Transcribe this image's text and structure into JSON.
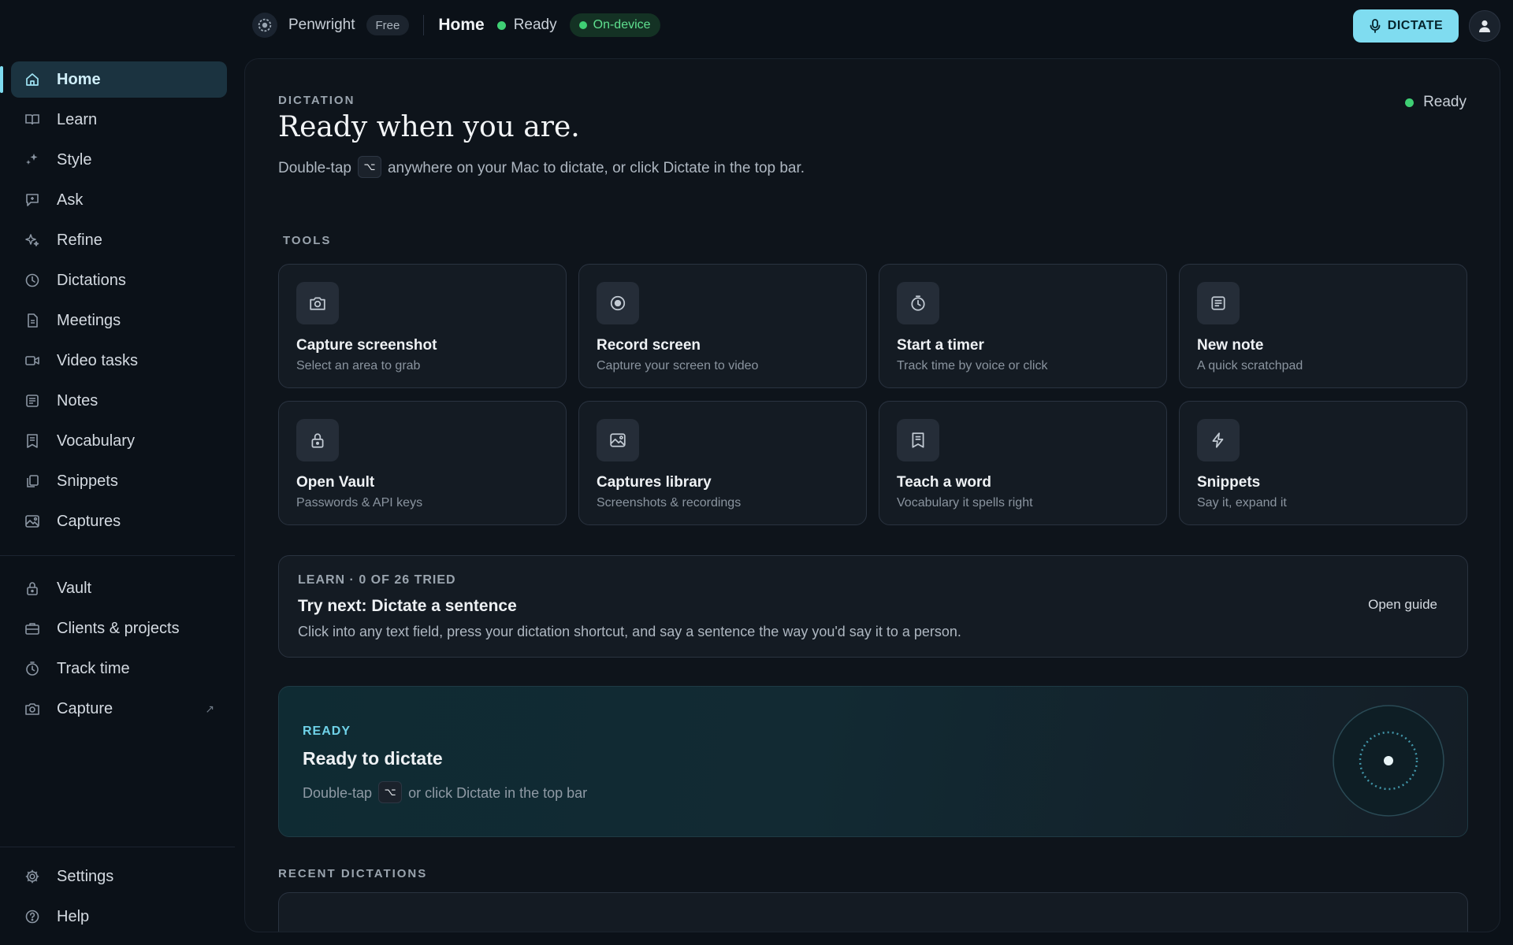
{
  "topbar": {
    "app_name": "Penwright",
    "plan": "Free",
    "page_title": "Home",
    "status": "Ready",
    "mode": "On-device",
    "dictate_label": "DICTATE"
  },
  "sidebar": {
    "primary": [
      {
        "label": "Home",
        "icon": "home-icon",
        "active": true
      },
      {
        "label": "Learn",
        "icon": "book-icon"
      },
      {
        "label": "Style",
        "icon": "sparkle-icon"
      },
      {
        "label": "Ask",
        "icon": "chat-icon"
      },
      {
        "label": "Refine",
        "icon": "stars-icon"
      },
      {
        "label": "Dictations",
        "icon": "clock-icon"
      },
      {
        "label": "Meetings",
        "icon": "document-icon"
      },
      {
        "label": "Video tasks",
        "icon": "video-icon"
      },
      {
        "label": "Notes",
        "icon": "notes-icon"
      },
      {
        "label": "Vocabulary",
        "icon": "bookmark-icon"
      },
      {
        "label": "Snippets",
        "icon": "copy-icon"
      },
      {
        "label": "Captures",
        "icon": "image-icon"
      }
    ],
    "secondary": [
      {
        "label": "Vault",
        "icon": "lock-icon"
      },
      {
        "label": "Clients & projects",
        "icon": "briefcase-icon"
      },
      {
        "label": "Track time",
        "icon": "timer-icon"
      },
      {
        "label": "Capture",
        "icon": "camera-icon",
        "external": "↗"
      }
    ],
    "footer": [
      {
        "label": "Settings",
        "icon": "gear-icon"
      },
      {
        "label": "Help",
        "icon": "help-icon"
      }
    ]
  },
  "main": {
    "section_label": "DICTATION",
    "title": "Ready when you are.",
    "desc_before": "Double-tap",
    "shortcut_key": "⌥",
    "desc_after": "anywhere on your Mac to dictate, or click Dictate in the top bar.",
    "status": "Ready",
    "tools_label": "TOOLS",
    "tools": [
      {
        "title": "Capture screenshot",
        "subtitle": "Select an area to grab",
        "icon": "camera-icon"
      },
      {
        "title": "Record screen",
        "subtitle": "Capture your screen to video",
        "icon": "record-icon"
      },
      {
        "title": "Start a timer",
        "subtitle": "Track time by voice or click",
        "icon": "timer-icon"
      },
      {
        "title": "New note",
        "subtitle": "A quick scratchpad",
        "icon": "notes-icon"
      },
      {
        "title": "Open Vault",
        "subtitle": "Passwords & API keys",
        "icon": "lock-icon"
      },
      {
        "title": "Captures library",
        "subtitle": "Screenshots & recordings",
        "icon": "image-icon"
      },
      {
        "title": "Teach a word",
        "subtitle": "Vocabulary it spells right",
        "icon": "bookmark-icon"
      },
      {
        "title": "Snippets",
        "subtitle": "Say it, expand it",
        "icon": "bolt-icon"
      }
    ],
    "learn": {
      "eyebrow": "LEARN · 0 OF 26 TRIED",
      "title": "Try next: Dictate a sentence",
      "desc": "Click into any text field, press your dictation shortcut, and say a sentence the way you'd say it to a person.",
      "link": "Open guide"
    },
    "ready_card": {
      "eyebrow": "READY",
      "title": "Ready to dictate",
      "desc_before": "Double-tap",
      "shortcut_key": "⌥",
      "desc_after": "or click Dictate in the top bar"
    },
    "recent_label": "RECENT DICTATIONS"
  },
  "colors": {
    "accent": "#7fdcf0",
    "status_green": "#3fcf74",
    "background": "#0b1118",
    "panel": "#0e141b",
    "card": "#141b23"
  }
}
